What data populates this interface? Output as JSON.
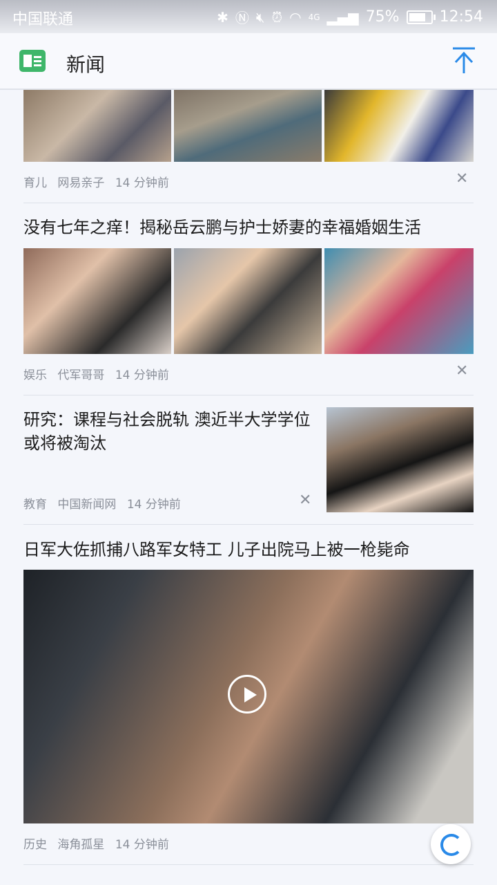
{
  "status": {
    "carrier": "中国联通",
    "signal_type": "4G",
    "battery": "75%",
    "time": "12:54"
  },
  "header": {
    "title": "新闻"
  },
  "news": [
    {
      "category": "育儿",
      "source": "网易亲子",
      "time": "14 分钟前"
    },
    {
      "title": "没有七年之痒！揭秘岳云鹏与护士娇妻的幸福婚姻生活",
      "category": "娱乐",
      "source": "代军哥哥",
      "time": "14 分钟前"
    },
    {
      "title": "研究：课程与社会脱轨 澳近半大学学位或将被淘汰",
      "category": "教育",
      "source": "中国新闻网",
      "time": "14 分钟前"
    },
    {
      "title": "日军大佐抓捕八路军女特工 儿子出院马上被一枪毙命",
      "category": "历史",
      "source": "海角孤星",
      "time": "14 分钟前"
    }
  ],
  "colors": {
    "accent": "#2a8ae8",
    "app_icon": "#3fb66a",
    "meta": "#8a8f99"
  },
  "icons": [
    "bluetooth-icon",
    "nfc-icon",
    "mute-icon",
    "alarm-icon",
    "wifi-icon",
    "signal-icon",
    "battery-icon",
    "back-to-top-icon",
    "close-icon",
    "play-icon",
    "refresh-icon"
  ]
}
